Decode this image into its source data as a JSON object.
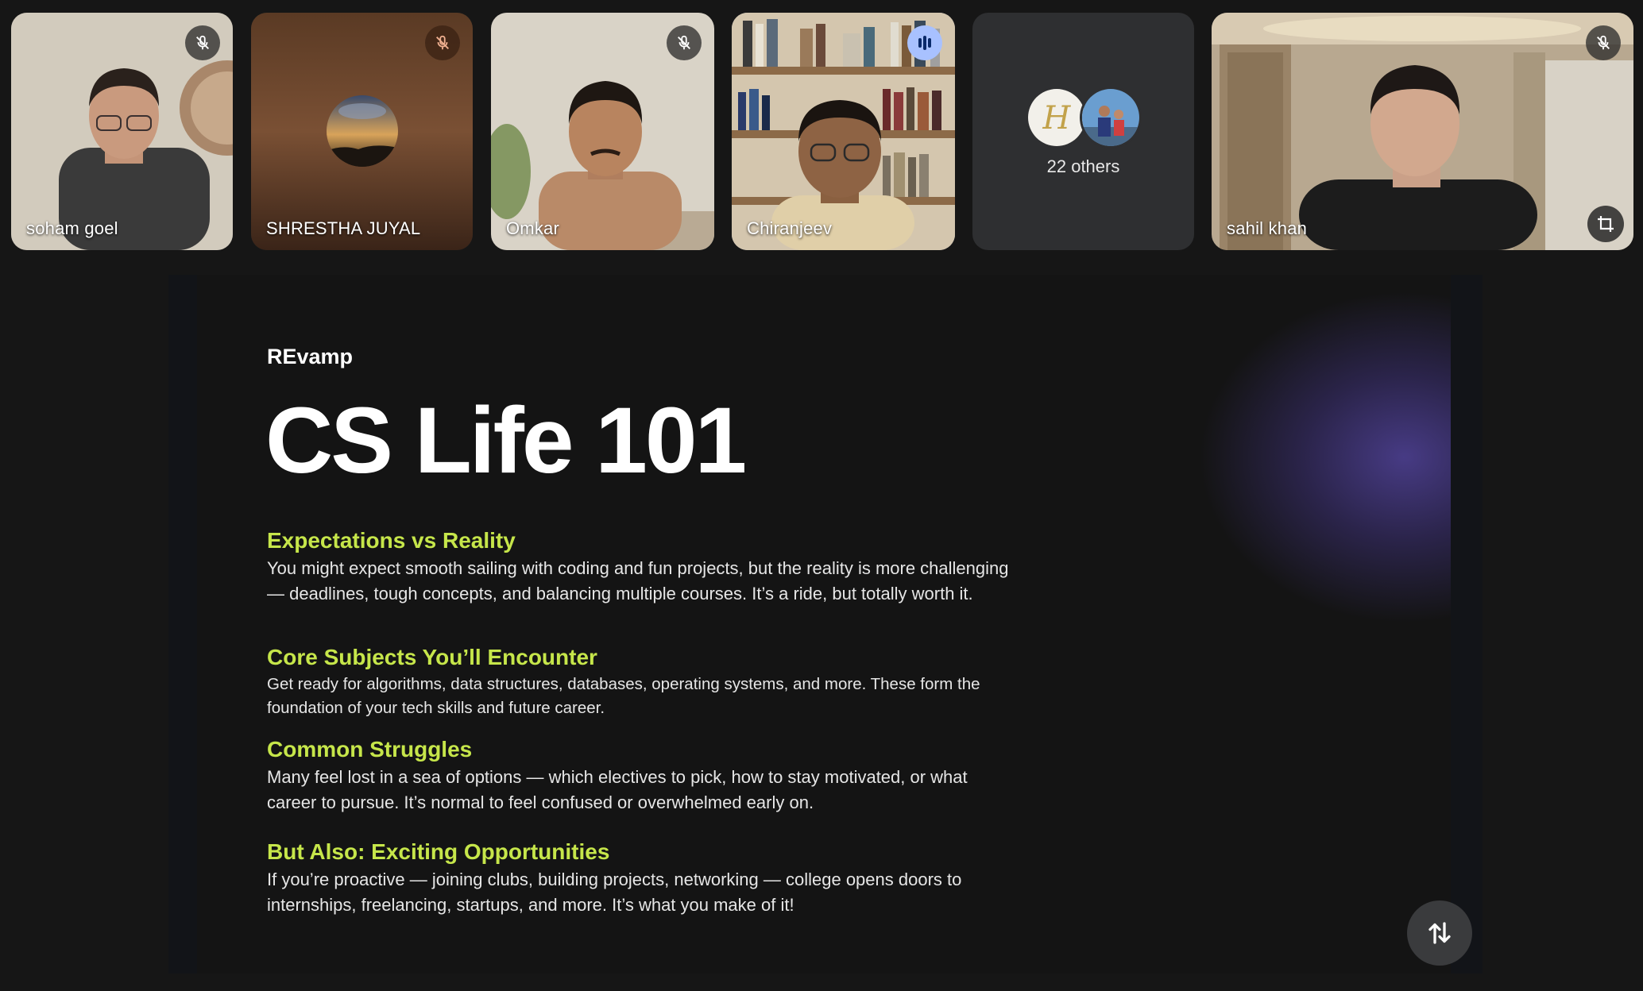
{
  "participants": [
    {
      "name": "soham goel",
      "muted": true
    },
    {
      "name": "SHRESTHA JUYAL",
      "muted": true
    },
    {
      "name": "Omkar",
      "muted": true
    },
    {
      "name": "Chiranjeev",
      "speaking": true
    },
    {
      "name": "sahil khan",
      "muted": true
    }
  ],
  "others": {
    "label": "22 others"
  },
  "slide": {
    "brand": "REvamp",
    "title": "CS Life 101",
    "sections": [
      {
        "heading": "Expectations vs Reality",
        "body": "You might expect smooth sailing with coding and fun projects, but the reality is more challenging — deadlines, tough concepts, and balancing multiple courses. It’s a ride, but totally worth it."
      },
      {
        "heading": "Core Subjects You’ll Encounter",
        "body": "Get ready for algorithms, data structures, databases, operating systems, and more. These form the foundation of your tech skills and future career."
      },
      {
        "heading": "Common Struggles",
        "body": "Many feel lost in a sea of options — which electives to pick, how to stay motivated, or what career to pursue. It’s normal to feel confused or overwhelmed early on."
      },
      {
        "heading": "But Also: Exciting Opportunities",
        "body": "If you’re proactive — joining clubs, building projects, networking — college opens doors to internships, freelancing, startups, and more. It’s what you make of it!"
      }
    ]
  },
  "icons": {
    "mic_off": "mic-off-icon",
    "speaking": "audio-level-icon",
    "crop": "crop-icon",
    "swap": "swap-vertical-icon"
  },
  "colors": {
    "heading_accent": "#c6e64a",
    "active_border": "#a8c1ff",
    "background": "#161616"
  }
}
